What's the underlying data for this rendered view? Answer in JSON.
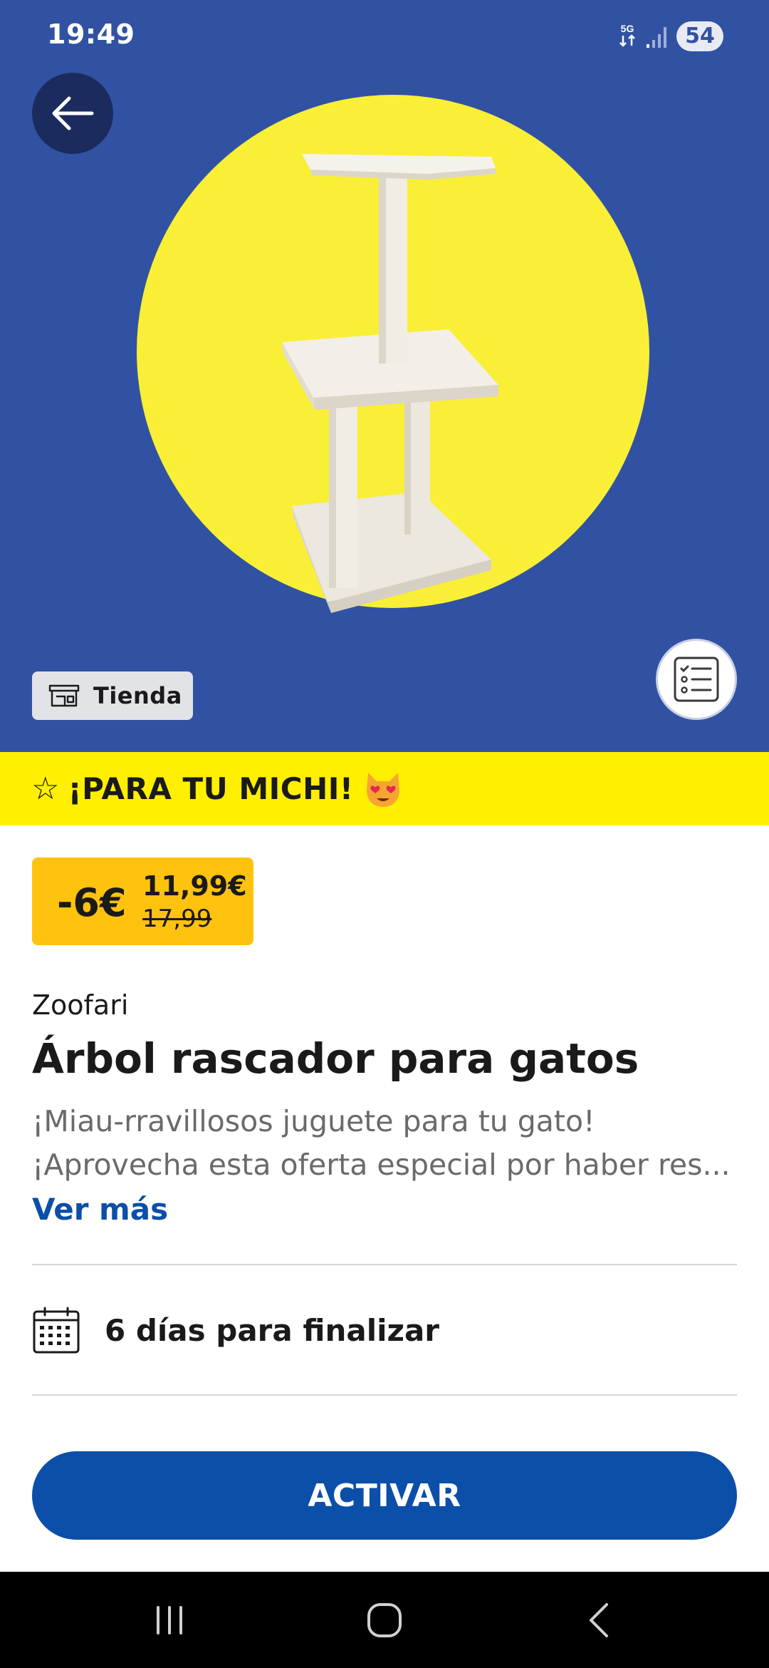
{
  "status_bar": {
    "time": "19:49",
    "network": "5G",
    "battery": "54"
  },
  "hero": {
    "background_color": "#3152a3",
    "circle_color": "#f9ef36",
    "back_icon": "arrow-left-icon",
    "store_chip": {
      "icon": "store-icon",
      "label": "Tienda"
    },
    "list_icon": "checklist-icon"
  },
  "banner": {
    "icon": "star-outline-icon",
    "text": "¡PARA TU MICHI!",
    "emoji": "heart-eyes-cat-emoji",
    "background_color": "#fff000"
  },
  "price": {
    "discount": "-6€",
    "new_price": "11,99€",
    "old_price": "17,99",
    "badge_color": "#ffc20e"
  },
  "product": {
    "brand": "Zoofari",
    "title": "Árbol rascador para gatos",
    "description_lines": [
      "¡Miau-rravillosos juguete para tu gato!",
      "¡Aprovecha esta oferta especial por haber res..."
    ],
    "see_more": "Ver más"
  },
  "validity": {
    "icon": "calendar-icon",
    "text": "6 días para finalizar"
  },
  "cta": {
    "label": "ACTIVAR",
    "color": "#0b4fa8"
  },
  "nav_bar": {
    "recents_icon": "recents-icon",
    "home_icon": "home-icon",
    "back_icon": "back-chevron-icon"
  }
}
